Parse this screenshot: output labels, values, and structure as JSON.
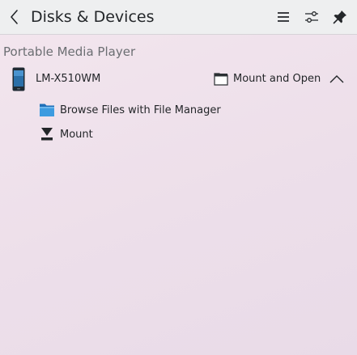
{
  "window": {
    "title": "Disks & Devices"
  },
  "header": {
    "back_icon": "chevron-left-icon",
    "menu_icon": "hamburger-menu-icon",
    "configure_icon": "sliders-icon",
    "pin_icon": "pin-icon"
  },
  "section": {
    "label": "Portable Media Player"
  },
  "device": {
    "name": "LM-X510WM",
    "icon": "phone-icon",
    "action_label": "Mount and Open",
    "action_icon": "folder-icon",
    "expanded": true
  },
  "actions": [
    {
      "label": "Browse Files with File Manager",
      "icon": "blue-folder-icon"
    },
    {
      "label": "Mount",
      "icon": "mount-icon"
    }
  ],
  "colors": {
    "accent": "#3daee9",
    "header_bg": "#eeeff0",
    "text": "#232629",
    "muted_text": "#6b6e72"
  }
}
